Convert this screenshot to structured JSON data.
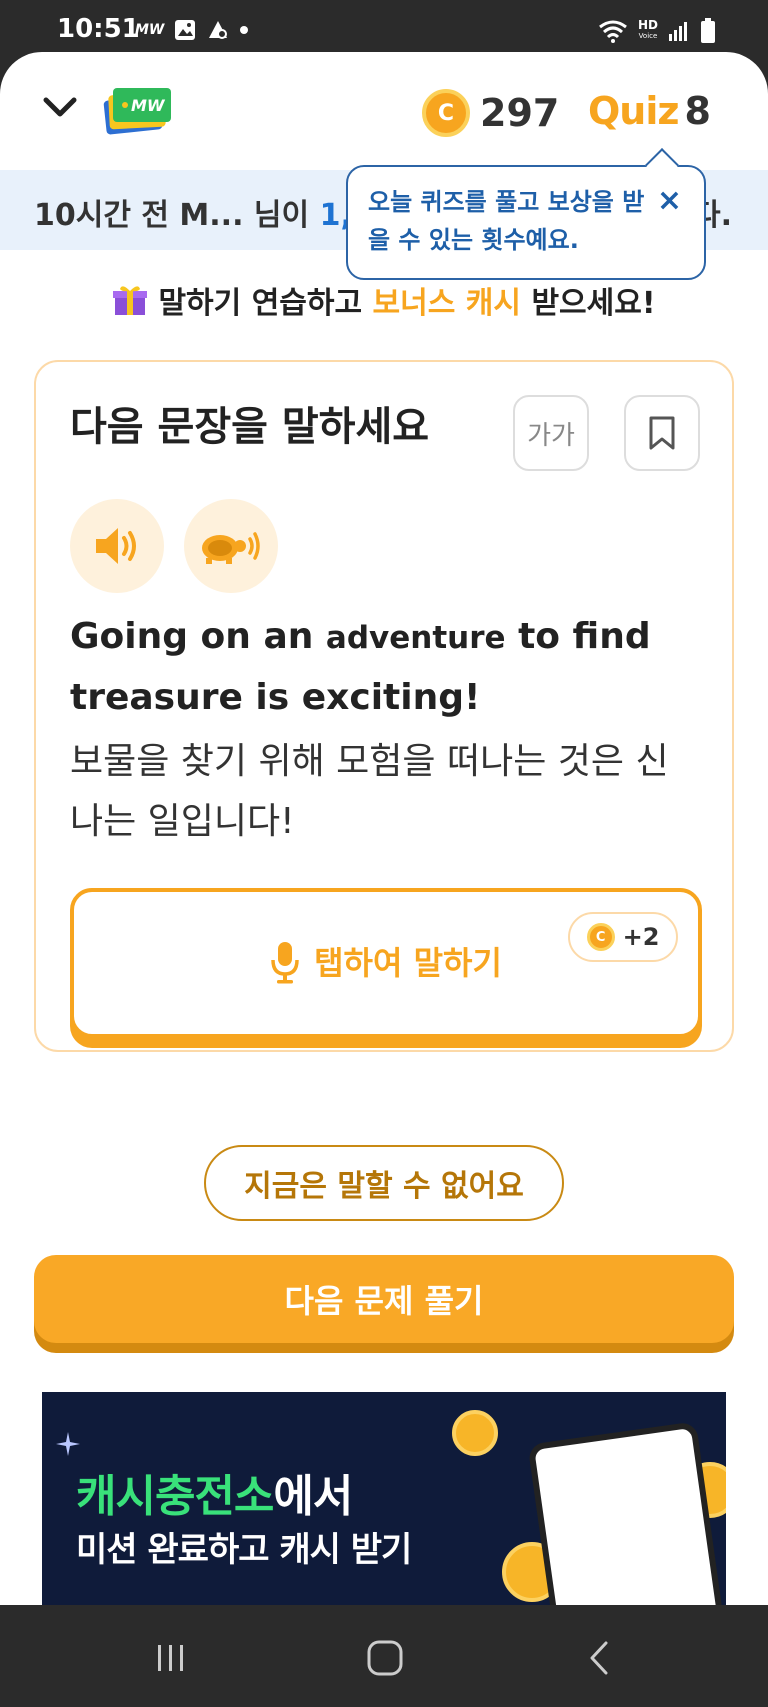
{
  "status_bar": {
    "time": "10:51",
    "app_icon_text": "MW",
    "hd_label": "HD",
    "hd_sub": "Voice"
  },
  "header": {
    "coin_symbol": "C",
    "coin_count": "297",
    "quiz_logo": "Quiz",
    "quiz_count": "8"
  },
  "ticker": {
    "prefix": "10시간 전 M... 님이 ",
    "highlight": "1,",
    "suffix": "다."
  },
  "tooltip": {
    "text": "오늘 퀴즈를 풀고 보상을 받을 수 있는 횟수예요.",
    "close": "×"
  },
  "promo": {
    "part1": "말하기 연습하고 ",
    "highlight": "보너스 캐시",
    "part2": " 받으세요!"
  },
  "card": {
    "title": "다음 문장을 말하세요",
    "font_size_label": "가가",
    "sentence_en_pre": "Going on an ",
    "sentence_en_keyword": "adventure",
    "sentence_en_post": " to find treasure is exciting!",
    "sentence_ko": "보물을 찾기 위해 모험을 떠나는 것은 신나는 일입니다!",
    "speak_label": "탭하여 말하기",
    "reward": "+2"
  },
  "actions": {
    "cant_speak": "지금은 말할 수 없어요",
    "next": "다음 문제 풀기"
  },
  "banner": {
    "line1_green": "캐시충전소",
    "line1_white": "에서",
    "line2": "미션 완료하고 캐시 받기"
  },
  "colors": {
    "accent": "#f7a51f",
    "ticker_bg": "#e8f1fb",
    "tooltip_blue": "#1e5fa8",
    "banner_bg": "#0f1b3a"
  }
}
